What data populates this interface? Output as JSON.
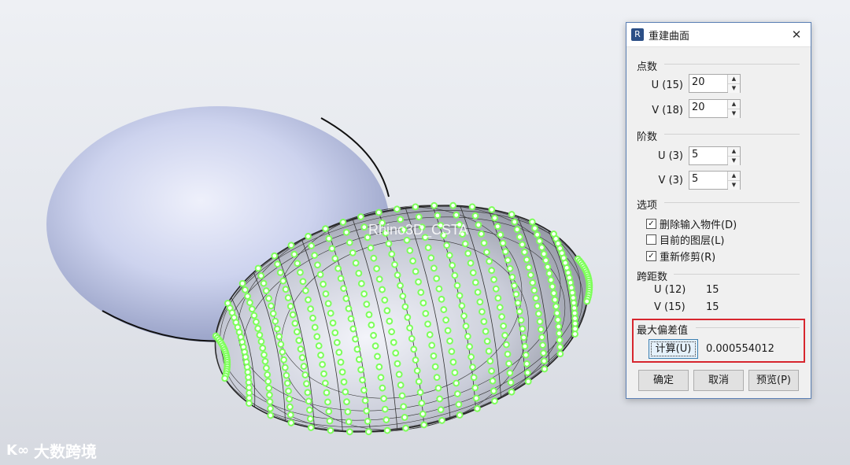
{
  "viewport": {
    "watermark": "Rhino3D_CSTA",
    "brand_logo": "K∞",
    "brand_text": "大数跨境"
  },
  "dialog": {
    "title": "重建曲面",
    "icon": "rhino-icon",
    "close_glyph": "✕",
    "points": {
      "heading": "点数",
      "u_label": "U (15)",
      "u_value": "20",
      "v_label": "V (18)",
      "v_value": "20"
    },
    "degree": {
      "heading": "阶数",
      "u_label": "U (3)",
      "u_value": "5",
      "v_label": "V (3)",
      "v_value": "5"
    },
    "options": {
      "heading": "选项",
      "items": [
        {
          "label": "删除输入物件(D)",
          "checked": true,
          "mark": "✓"
        },
        {
          "label": "目前的图层(L)",
          "checked": false,
          "mark": ""
        },
        {
          "label": "重新修剪(R)",
          "checked": true,
          "mark": "✓"
        }
      ]
    },
    "spans": {
      "heading": "跨距数",
      "u_label": "U (12)",
      "u_value": "15",
      "v_label": "V (15)",
      "v_value": "15"
    },
    "max_deviation": {
      "heading": "最大偏差值",
      "calc_label": "计算(U)",
      "value": "0.000554012"
    },
    "buttons": {
      "ok": "确定",
      "cancel": "取消",
      "preview": "预览(P)"
    }
  },
  "colors": {
    "control_points": "#7dff5a",
    "highlight": "#d7262e",
    "accent": "#5a7fb4"
  }
}
